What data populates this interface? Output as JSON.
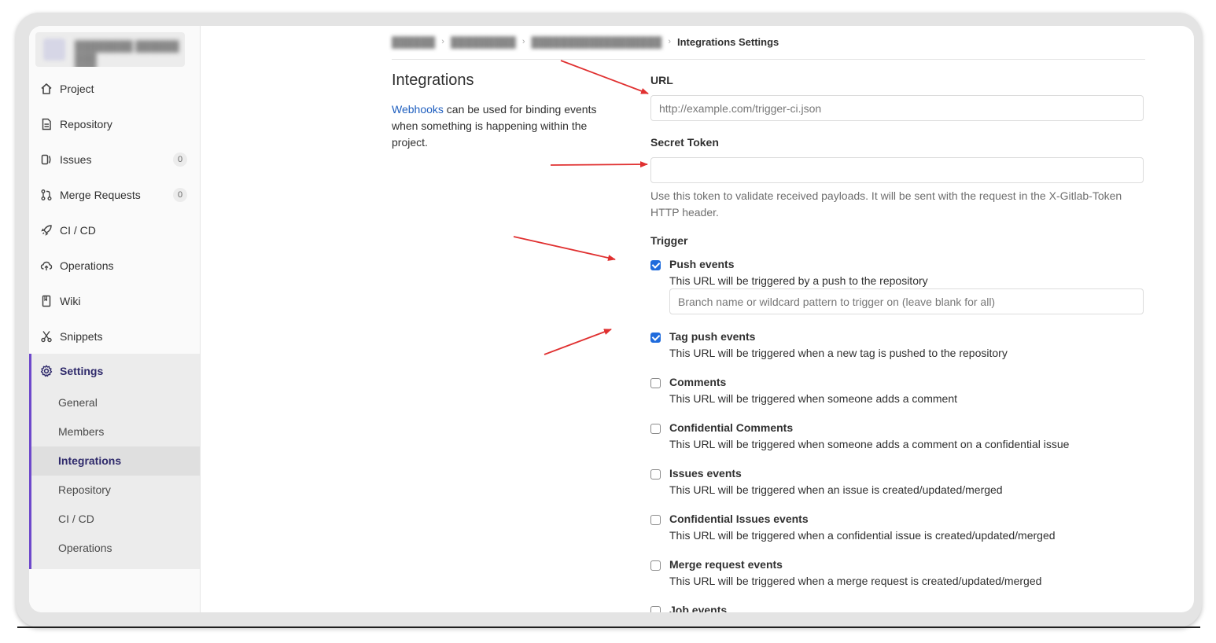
{
  "sidebar": {
    "items": [
      {
        "label": "Project",
        "icon": "home-icon"
      },
      {
        "label": "Repository",
        "icon": "document-icon"
      },
      {
        "label": "Issues",
        "icon": "issues-icon",
        "count": "0"
      },
      {
        "label": "Merge Requests",
        "icon": "merge-request-icon",
        "count": "0"
      },
      {
        "label": "CI / CD",
        "icon": "rocket-icon"
      },
      {
        "label": "Operations",
        "icon": "cloud-icon"
      },
      {
        "label": "Wiki",
        "icon": "book-icon"
      },
      {
        "label": "Snippets",
        "icon": "scissors-icon"
      }
    ],
    "settings": {
      "label": "Settings",
      "icon": "gear-icon",
      "sub_items": [
        {
          "label": "General"
        },
        {
          "label": "Members"
        },
        {
          "label": "Integrations",
          "active": true
        },
        {
          "label": "Repository"
        },
        {
          "label": "CI / CD"
        },
        {
          "label": "Operations"
        }
      ]
    }
  },
  "breadcrumb": {
    "current": "Integrations Settings"
  },
  "intro": {
    "title": "Integrations",
    "link_text": "Webhooks",
    "description": " can be used for binding events when something is happening within the project."
  },
  "form": {
    "url_label": "URL",
    "url_placeholder": "http://example.com/trigger-ci.json",
    "url_value": "",
    "token_label": "Secret Token",
    "token_value": "",
    "token_help": "Use this token to validate received payloads. It will be sent with the request in the X-Gitlab-Token HTTP header.",
    "trigger_label": "Trigger",
    "branch_placeholder": "Branch name or wildcard pattern to trigger on (leave blank for all)",
    "triggers": [
      {
        "name": "Push events",
        "desc": "This URL will be triggered by a push to the repository",
        "checked": true
      },
      {
        "name": "Tag push events",
        "desc": "This URL will be triggered when a new tag is pushed to the repository",
        "checked": true
      },
      {
        "name": "Comments",
        "desc": "This URL will be triggered when someone adds a comment",
        "checked": false
      },
      {
        "name": "Confidential Comments",
        "desc": "This URL will be triggered when someone adds a comment on a confidential issue",
        "checked": false
      },
      {
        "name": "Issues events",
        "desc": "This URL will be triggered when an issue is created/updated/merged",
        "checked": false
      },
      {
        "name": "Confidential Issues events",
        "desc": "This URL will be triggered when a confidential issue is created/updated/merged",
        "checked": false
      },
      {
        "name": "Merge request events",
        "desc": "This URL will be triggered when a merge request is created/updated/merged",
        "checked": false
      },
      {
        "name": "Job events",
        "desc": "",
        "checked": false
      }
    ]
  },
  "colors": {
    "accent": "#6e49cb",
    "link": "#1f5fbf",
    "checkbox": "#1f6bdc",
    "annotation_arrow": "#e03030"
  }
}
